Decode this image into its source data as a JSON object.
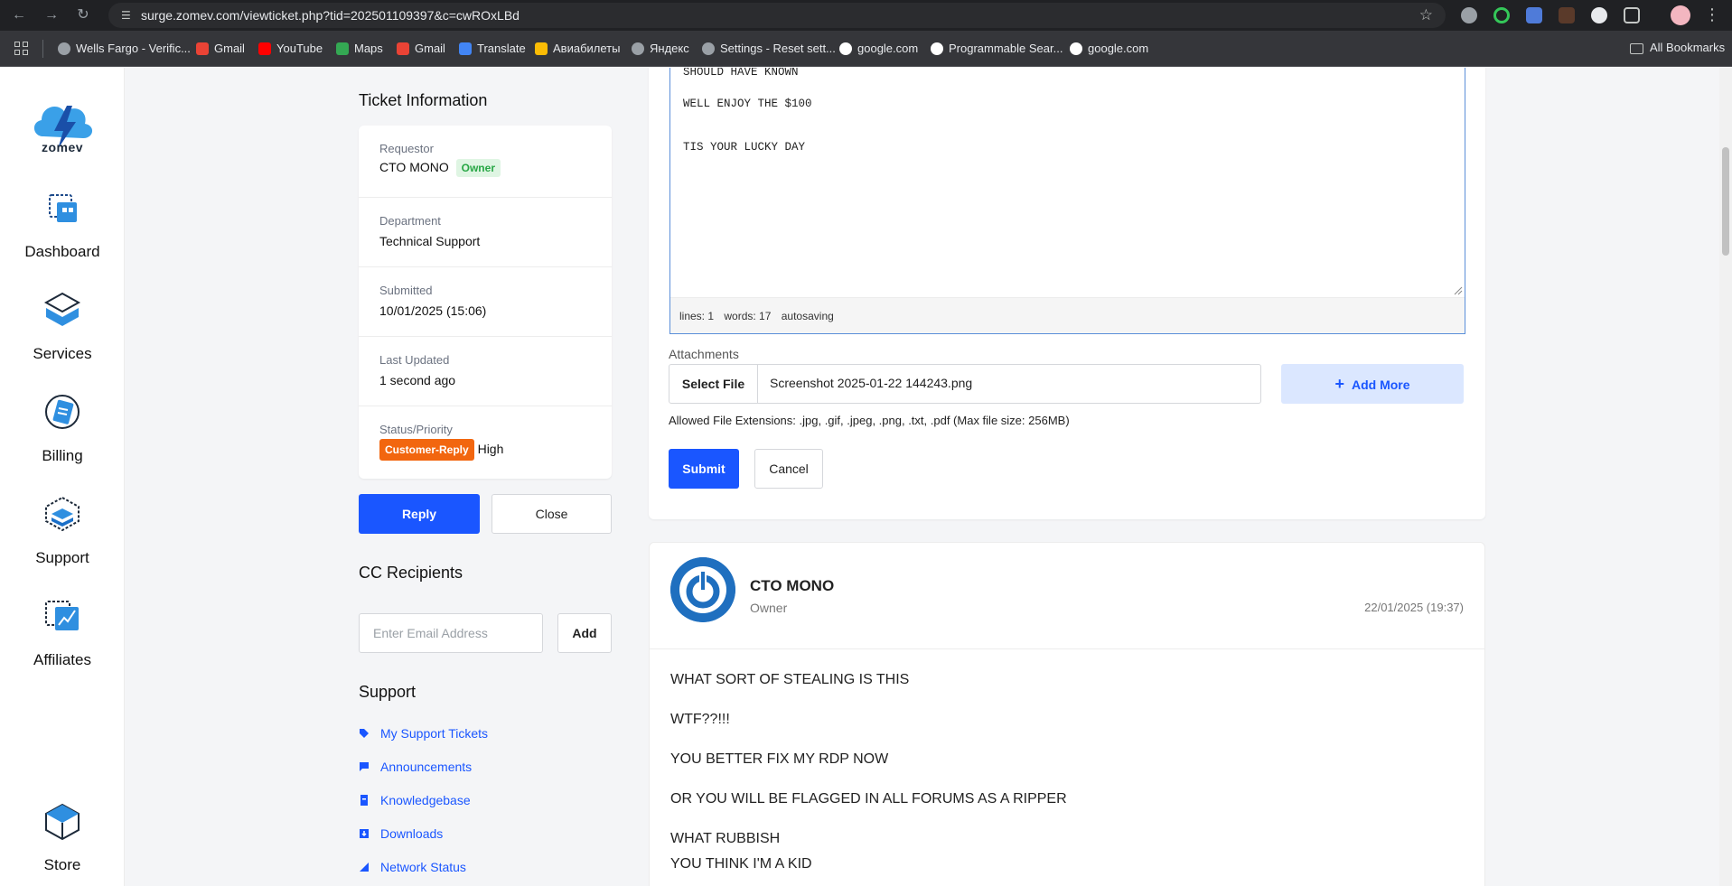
{
  "browser": {
    "url": "surge.zomev.com/viewticket.php?tid=202501109397&c=cwROxLBd",
    "bookmarks": [
      {
        "label": "Wells Fargo - Verific...",
        "icon": "globe-icon"
      },
      {
        "label": "Gmail",
        "icon": "gmail-icon"
      },
      {
        "label": "YouTube",
        "icon": "youtube-icon"
      },
      {
        "label": "Maps",
        "icon": "maps-icon"
      },
      {
        "label": "Gmail",
        "icon": "gmail-icon"
      },
      {
        "label": "Translate",
        "icon": "translate-icon"
      },
      {
        "label": "Авиабилеты",
        "icon": "ticket-icon"
      },
      {
        "label": "Яндекс",
        "icon": "globe-icon"
      },
      {
        "label": "Settings - Reset sett...",
        "icon": "gear-icon"
      },
      {
        "label": "google.com",
        "icon": "google-icon"
      },
      {
        "label": "Programmable Sear...",
        "icon": "google-icon"
      },
      {
        "label": "google.com",
        "icon": "google-icon"
      }
    ],
    "all_bookmarks": "All Bookmarks"
  },
  "sidebar": {
    "logo_text": "zomev",
    "items": [
      {
        "label": "Dashboard",
        "icon": "dashboard-icon"
      },
      {
        "label": "Services",
        "icon": "services-icon"
      },
      {
        "label": "Billing",
        "icon": "billing-icon"
      },
      {
        "label": "Support",
        "icon": "support-icon"
      },
      {
        "label": "Affiliates",
        "icon": "affiliates-icon"
      },
      {
        "label": "Store",
        "icon": "store-icon"
      }
    ]
  },
  "ticket_info": {
    "title": "Ticket Information",
    "requestor_label": "Requestor",
    "requestor": "CTO MONO",
    "requestor_badge": "Owner",
    "department_label": "Department",
    "department": "Technical Support",
    "submitted_label": "Submitted",
    "submitted": "10/01/2025 (15:06)",
    "updated_label": "Last Updated",
    "updated": "1 second ago",
    "status_label": "Status/Priority",
    "status": "Customer-Reply",
    "priority": "High",
    "reply_button": "Reply",
    "close_button": "Close"
  },
  "cc": {
    "title": "CC Recipients",
    "placeholder": "Enter Email Address",
    "add_button": "Add"
  },
  "support": {
    "title": "Support",
    "links": [
      {
        "label": "My Support Tickets",
        "icon": "tag-icon"
      },
      {
        "label": "Announcements",
        "icon": "comment-icon"
      },
      {
        "label": "Knowledgebase",
        "icon": "document-icon"
      },
      {
        "label": "Downloads",
        "icon": "download-icon"
      },
      {
        "label": "Network Status",
        "icon": "signal-icon"
      }
    ]
  },
  "reply": {
    "editor_lines": [
      "SHOULD HAVE KNOWN",
      "WELL ENJOY THE $100",
      "TIS YOUR LUCKY DAY"
    ],
    "status_lines": "lines: 1",
    "status_words": "words: 17",
    "status_saving": "autosaving",
    "attachments_label": "Attachments",
    "select_file": "Select File",
    "file_name": "Screenshot 2025-01-22 144243.png",
    "add_more": "Add More",
    "allowed": "Allowed File Extensions: .jpg, .gif, .jpeg, .png, .txt, .pdf (Max file size: 256MB)",
    "submit": "Submit",
    "cancel": "Cancel"
  },
  "message": {
    "author": "CTO MONO",
    "role": "Owner",
    "date": "22/01/2025 (19:37)",
    "lines": [
      "WHAT SORT OF STEALING IS THIS",
      "WTF??!!!",
      "YOU BETTER FIX MY RDP NOW",
      "OR YOU WILL BE FLAGGED IN ALL FORUMS AS A RIPPER",
      "WHAT RUBBISH",
      "YOU THINK I'M A KID"
    ]
  },
  "colors": {
    "primary": "#1a56ff",
    "status_customer_reply": "#f2660f",
    "owner_badge": "#28a745"
  }
}
